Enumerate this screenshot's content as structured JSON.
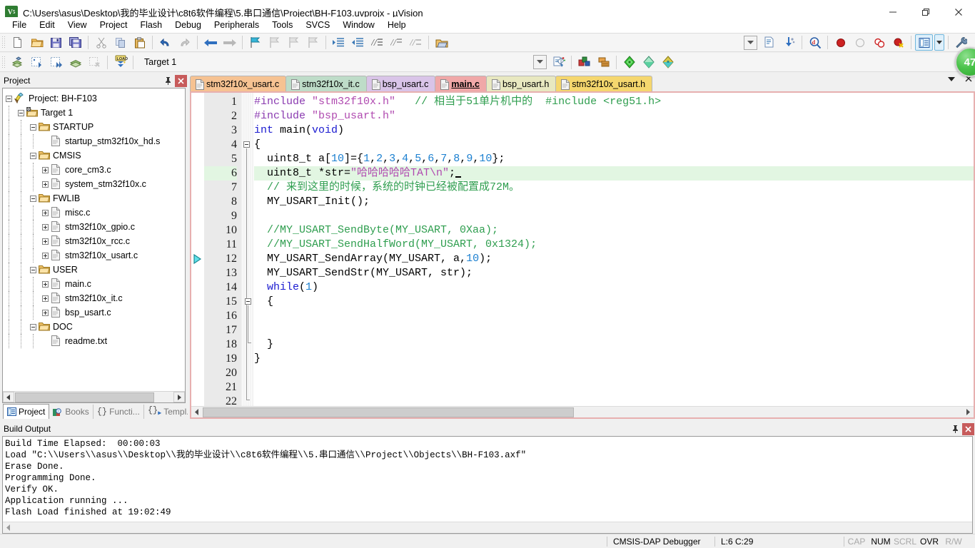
{
  "window": {
    "title": "C:\\Users\\asus\\Desktop\\我的毕业设计\\c8t6软件编程\\5.串口通信\\Project\\BH-F103.uvprojx - µVision",
    "app_icon": "uvision-logo-icon",
    "minimize": "—",
    "maximize": "❐",
    "close": "✕"
  },
  "menu": {
    "items": [
      {
        "label": "File"
      },
      {
        "label": "Edit"
      },
      {
        "label": "View"
      },
      {
        "label": "Project"
      },
      {
        "label": "Flash"
      },
      {
        "label": "Debug"
      },
      {
        "label": "Peripherals"
      },
      {
        "label": "Tools"
      },
      {
        "label": "SVCS"
      },
      {
        "label": "Window"
      },
      {
        "label": "Help"
      }
    ]
  },
  "toolbar_main": {
    "buttons": [
      "new-file-icon",
      "open-file-icon",
      "save-icon",
      "save-all-icon",
      "cut-icon",
      "copy-icon",
      "paste-icon",
      "undo-icon",
      "redo-icon",
      "navigate-back-icon",
      "navigate-forward-icon",
      "bookmark-toggle-icon",
      "bookmark-prev-icon",
      "bookmark-next-icon",
      "bookmark-clear-icon",
      "indent-icon",
      "outdent-icon",
      "comment-icon",
      "uncomment-icon",
      "uncomment-all-icon",
      "open-folder-icon"
    ]
  },
  "toolbar_build": {
    "buttons": [
      "translate-icon",
      "build-icon",
      "rebuild-icon",
      "batch-build-icon",
      "stop-build-icon",
      "download-icon"
    ],
    "target_value": "Target 1",
    "target_dropdown_icon": "chevron-down-icon",
    "manage_targets_icon": "manage-project-items-icon",
    "after": [
      "configure-target-icon",
      "manage-components-icon",
      "debug-settings-icon",
      "start-debug-icon",
      "flash-download-icon"
    ],
    "right_buttons": [
      "chevron-down-icon",
      "insert-file-icon",
      "configure-icon",
      "find-in-files-icon",
      "breakpoint-icon",
      "breakpoint-disable-icon",
      "breakpoint-disable-all-icon",
      "breakpoint-kill-all-icon",
      "window-layout-icon",
      "window-layout-dropdown-icon",
      "configure-tools-icon"
    ]
  },
  "green_badge": {
    "value": "47"
  },
  "project_panel": {
    "caption": "Project",
    "pin_icon": "pin-icon",
    "close_icon": "close-icon",
    "tree": [
      {
        "label": "Project: BH-F103",
        "depth": 0,
        "expander": "minus",
        "icon": "project-icon"
      },
      {
        "label": "Target 1",
        "depth": 1,
        "expander": "minus",
        "icon": "target-icon"
      },
      {
        "label": "STARTUP",
        "depth": 2,
        "expander": "minus",
        "icon": "folder-icon"
      },
      {
        "label": "startup_stm32f10x_hd.s",
        "depth": 3,
        "expander": "none",
        "icon": "file-icon"
      },
      {
        "label": "CMSIS",
        "depth": 2,
        "expander": "minus",
        "icon": "folder-icon"
      },
      {
        "label": "core_cm3.c",
        "depth": 3,
        "expander": "plus",
        "icon": "file-icon"
      },
      {
        "label": "system_stm32f10x.c",
        "depth": 3,
        "expander": "plus",
        "icon": "file-icon"
      },
      {
        "label": "FWLIB",
        "depth": 2,
        "expander": "minus",
        "icon": "folder-icon"
      },
      {
        "label": "misc.c",
        "depth": 3,
        "expander": "plus",
        "icon": "file-icon"
      },
      {
        "label": "stm32f10x_gpio.c",
        "depth": 3,
        "expander": "plus",
        "icon": "file-icon"
      },
      {
        "label": "stm32f10x_rcc.c",
        "depth": 3,
        "expander": "plus",
        "icon": "file-icon"
      },
      {
        "label": "stm32f10x_usart.c",
        "depth": 3,
        "expander": "plus",
        "icon": "file-icon"
      },
      {
        "label": "USER",
        "depth": 2,
        "expander": "minus",
        "icon": "folder-icon"
      },
      {
        "label": "main.c",
        "depth": 3,
        "expander": "plus",
        "icon": "file-icon"
      },
      {
        "label": "stm32f10x_it.c",
        "depth": 3,
        "expander": "plus",
        "icon": "file-icon"
      },
      {
        "label": "bsp_usart.c",
        "depth": 3,
        "expander": "plus",
        "icon": "file-icon"
      },
      {
        "label": "DOC",
        "depth": 2,
        "expander": "minus",
        "icon": "folder-icon"
      },
      {
        "label": "readme.txt",
        "depth": 3,
        "expander": "none",
        "icon": "file-icon"
      }
    ],
    "bottom_tabs": [
      {
        "label": "Project",
        "icon": "project-window-icon",
        "selected": true
      },
      {
        "label": "Books",
        "icon": "books-icon",
        "selected": false
      },
      {
        "label": "Functi...",
        "icon": "functions-icon",
        "selected": false
      },
      {
        "label": "Templ...",
        "icon": "templates-icon",
        "selected": false
      }
    ]
  },
  "editor": {
    "tabs": [
      {
        "label": "stm32f10x_usart.c",
        "color": "#f6c292",
        "active": false
      },
      {
        "label": "stm32f10x_it.c",
        "color": "#bedcc8",
        "active": false
      },
      {
        "label": "bsp_usart.c",
        "color": "#d9c4e8",
        "active": false
      },
      {
        "label": "main.c",
        "color": "#f0a8a8",
        "active": true
      },
      {
        "label": "bsp_usart.h",
        "color": "#e8e8c0",
        "active": false
      },
      {
        "label": "stm32f10x_usart.h",
        "color": "#f5d76e",
        "active": false
      }
    ],
    "tab_dropdown_icon": "chevron-down-icon",
    "tab_close_icon": "close-icon",
    "current_line": 6,
    "exec_pointer_line": 12,
    "lines": [
      {
        "n": 1,
        "tokens": [
          {
            "t": "#include ",
            "c": "pp"
          },
          {
            "t": "\"stm32f10x.h\"",
            "c": "str"
          },
          {
            "t": "   ",
            "c": "plain"
          },
          {
            "t": "// 相当于51单片机中的  #include <reg51.h>",
            "c": "cmt"
          }
        ]
      },
      {
        "n": 2,
        "tokens": [
          {
            "t": "#include ",
            "c": "pp"
          },
          {
            "t": "\"bsp_usart.h\"",
            "c": "str"
          }
        ]
      },
      {
        "n": 3,
        "tokens": [
          {
            "t": "int ",
            "c": "kw"
          },
          {
            "t": "main(",
            "c": "plain"
          },
          {
            "t": "void",
            "c": "kw"
          },
          {
            "t": ")",
            "c": "plain"
          }
        ]
      },
      {
        "n": 4,
        "tokens": [
          {
            "t": "{",
            "c": "plain"
          }
        ]
      },
      {
        "n": 5,
        "tokens": [
          {
            "t": "  uint8_t a[",
            "c": "plain"
          },
          {
            "t": "10",
            "c": "num"
          },
          {
            "t": "]={",
            "c": "plain"
          },
          {
            "t": "1",
            "c": "num"
          },
          {
            "t": ",",
            "c": "plain"
          },
          {
            "t": "2",
            "c": "num"
          },
          {
            "t": ",",
            "c": "plain"
          },
          {
            "t": "3",
            "c": "num"
          },
          {
            "t": ",",
            "c": "plain"
          },
          {
            "t": "4",
            "c": "num"
          },
          {
            "t": ",",
            "c": "plain"
          },
          {
            "t": "5",
            "c": "num"
          },
          {
            "t": ",",
            "c": "plain"
          },
          {
            "t": "6",
            "c": "num"
          },
          {
            "t": ",",
            "c": "plain"
          },
          {
            "t": "7",
            "c": "num"
          },
          {
            "t": ",",
            "c": "plain"
          },
          {
            "t": "8",
            "c": "num"
          },
          {
            "t": ",",
            "c": "plain"
          },
          {
            "t": "9",
            "c": "num"
          },
          {
            "t": ",",
            "c": "plain"
          },
          {
            "t": "10",
            "c": "num"
          },
          {
            "t": "};",
            "c": "plain"
          }
        ]
      },
      {
        "n": 6,
        "highlight": true,
        "caret": true,
        "tokens": [
          {
            "t": "  uint8_t *str=",
            "c": "plain"
          },
          {
            "t": "\"哈哈哈哈哈TAT\\n\"",
            "c": "str"
          },
          {
            "t": ";",
            "c": "plain"
          }
        ]
      },
      {
        "n": 7,
        "tokens": [
          {
            "t": "  // 来到这里的时候，系统的时钟已经被配置成72M。",
            "c": "cmt"
          }
        ]
      },
      {
        "n": 8,
        "tokens": [
          {
            "t": "  MY_USART_Init();",
            "c": "plain"
          }
        ]
      },
      {
        "n": 9,
        "tokens": []
      },
      {
        "n": 10,
        "tokens": [
          {
            "t": "  //MY_USART_SendByte(MY_USART, 0Xaa);",
            "c": "cmt"
          }
        ]
      },
      {
        "n": 11,
        "tokens": [
          {
            "t": "  //MY_USART_SendHalfWord(MY_USART, 0x1324);",
            "c": "cmt"
          }
        ]
      },
      {
        "n": 12,
        "tokens": [
          {
            "t": "  MY_USART_SendArray(MY_USART, a,",
            "c": "plain"
          },
          {
            "t": "10",
            "c": "num"
          },
          {
            "t": ");",
            "c": "plain"
          }
        ]
      },
      {
        "n": 13,
        "tokens": [
          {
            "t": "  MY_USART_SendStr(MY_USART, str);",
            "c": "plain"
          }
        ]
      },
      {
        "n": 14,
        "tokens": [
          {
            "t": "  while",
            "c": "kw"
          },
          {
            "t": "(",
            "c": "plain"
          },
          {
            "t": "1",
            "c": "num"
          },
          {
            "t": ")",
            "c": "plain"
          }
        ]
      },
      {
        "n": 15,
        "tokens": [
          {
            "t": "  {",
            "c": "plain"
          }
        ]
      },
      {
        "n": 16,
        "tokens": []
      },
      {
        "n": 17,
        "tokens": []
      },
      {
        "n": 18,
        "tokens": [
          {
            "t": "  }",
            "c": "plain"
          }
        ]
      },
      {
        "n": 19,
        "tokens": [
          {
            "t": "}",
            "c": "plain"
          }
        ]
      },
      {
        "n": 20,
        "tokens": []
      },
      {
        "n": 21,
        "tokens": []
      },
      {
        "n": 22,
        "tokens": []
      }
    ]
  },
  "build_output": {
    "caption": "Build Output",
    "pin_icon": "pin-icon",
    "close_icon": "close-icon",
    "lines": [
      "Build Time Elapsed:  00:00:03",
      "Load \"C:\\\\Users\\\\asus\\\\Desktop\\\\我的毕业设计\\\\c8t6软件编程\\\\5.串口通信\\\\Project\\\\Objects\\\\BH-F103.axf\"",
      "Erase Done.",
      "Programming Done.",
      "Verify OK.",
      "Application running ...",
      "Flash Load finished at 19:02:49"
    ]
  },
  "statusbar": {
    "debugger": "CMSIS-DAP Debugger",
    "position": "L:6 C:29",
    "indicators": [
      {
        "label": "CAP",
        "on": false
      },
      {
        "label": "NUM",
        "on": true
      },
      {
        "label": "SCRL",
        "on": false
      },
      {
        "label": "OVR",
        "on": true
      },
      {
        "label": "R/W",
        "on": false
      }
    ]
  }
}
